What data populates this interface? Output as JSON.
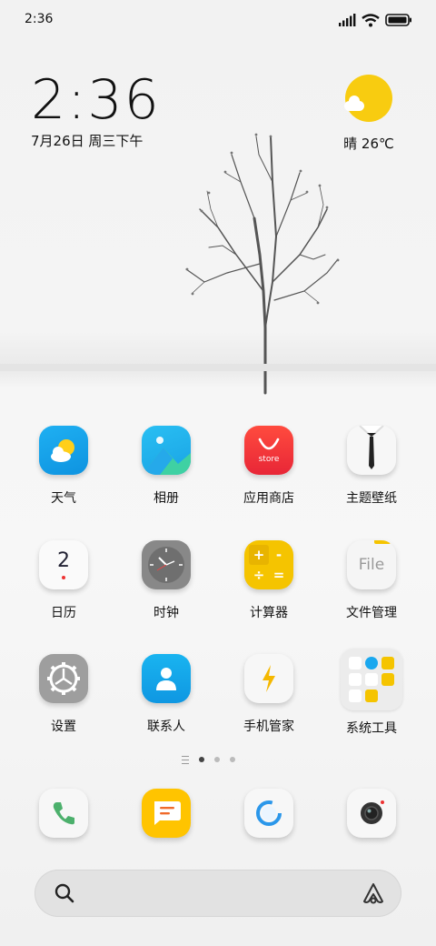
{
  "status_bar": {
    "time": "2:36",
    "signal_icon": "signal-icon",
    "wifi_icon": "wifi-icon",
    "battery_icon": "battery-icon"
  },
  "clock_widget": {
    "time": "2:36",
    "date": "7月26日 周三下午"
  },
  "weather_widget": {
    "icon": "partly-sunny-icon",
    "text": "晴 26℃"
  },
  "apps": [
    {
      "label": "天气",
      "icon": "weather-app-icon"
    },
    {
      "label": "相册",
      "icon": "gallery-app-icon"
    },
    {
      "label": "应用商店",
      "icon": "app-store-icon",
      "icon_text": "store"
    },
    {
      "label": "主题壁纸",
      "icon": "themes-app-icon"
    },
    {
      "label": "日历",
      "icon": "calendar-app-icon",
      "icon_text": "2"
    },
    {
      "label": "时钟",
      "icon": "clock-app-icon"
    },
    {
      "label": "计算器",
      "icon": "calculator-app-icon",
      "icon_text": [
        "+",
        "-",
        "÷",
        "="
      ]
    },
    {
      "label": "文件管理",
      "icon": "file-manager-icon",
      "icon_text": "File"
    },
    {
      "label": "设置",
      "icon": "settings-app-icon"
    },
    {
      "label": "联系人",
      "icon": "contacts-app-icon"
    },
    {
      "label": "手机管家",
      "icon": "phone-manager-icon"
    },
    {
      "label": "系统工具",
      "icon": "system-tools-folder-icon"
    }
  ],
  "page_indicator": {
    "pages": 3,
    "current": 1
  },
  "dock": [
    {
      "name": "phone",
      "icon": "phone-icon"
    },
    {
      "name": "messages",
      "icon": "messages-icon"
    },
    {
      "name": "browser",
      "icon": "browser-icon"
    },
    {
      "name": "camera",
      "icon": "camera-icon"
    }
  ],
  "search_bar": {
    "search_icon": "search-icon",
    "assistant_icon": "assistant-icon"
  },
  "colors": {
    "sun": "#f8cc10",
    "weather_blue": "#1ea7f0",
    "store_red": "#f2373a",
    "calculator_yellow": "#f5c400",
    "message_yellow": "#ffc400",
    "phone_green": "#4cb06c"
  }
}
